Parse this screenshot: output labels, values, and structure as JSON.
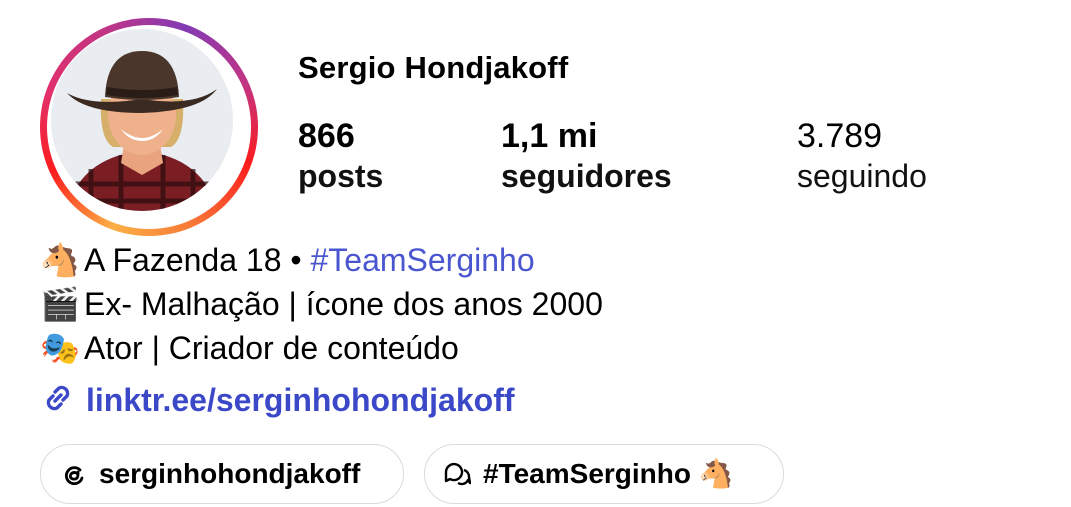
{
  "profile": {
    "username": "Sergio Hondjakoff",
    "stats": [
      {
        "value": "866",
        "label": "posts"
      },
      {
        "value": "1,1 mi",
        "label": "seguidores"
      },
      {
        "value": "3.789",
        "label": "seguindo"
      }
    ]
  },
  "bio": {
    "line1_emoji": "🐴",
    "line1_text": "A Fazenda 18 • ",
    "line1_hashtag": "#TeamSerginho",
    "line2_emoji": "🎬",
    "line2_text": "Ex- Malhação | ícone dos anos 2000",
    "line3_emoji": "🎭",
    "line3_text": "Ator | Criador de conteúdo",
    "link": "linktr.ee/serginhohondjakoff"
  },
  "chips": [
    {
      "icon": "threads-icon",
      "label": "serginhohondjakoff"
    },
    {
      "icon": "chat-bubbles-icon",
      "label": "#TeamSerginho",
      "emoji": "🐴"
    }
  ],
  "colors": {
    "link": "#3b48c8",
    "hashtag": "#4a56cf",
    "story_ring": [
      "#fcb045",
      "#fd1d1d",
      "#c13584",
      "#833ab4"
    ]
  }
}
